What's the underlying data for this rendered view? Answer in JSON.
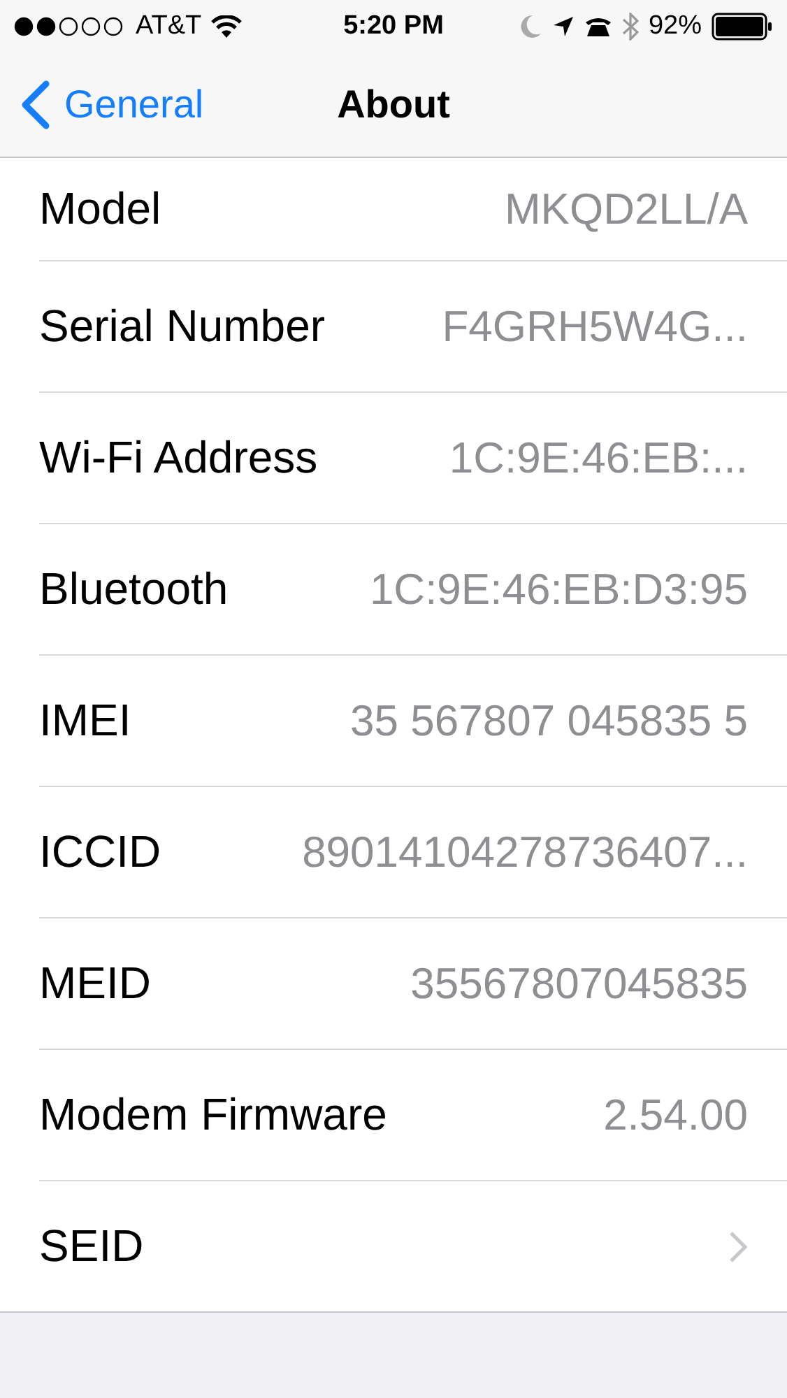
{
  "status_bar": {
    "carrier": "AT&T",
    "time": "5:20 PM",
    "battery": "92%"
  },
  "nav": {
    "back": "General",
    "title": "About"
  },
  "rows": [
    {
      "kind": "value",
      "label": "Model",
      "value": "MKQD2LL/A"
    },
    {
      "kind": "value",
      "label": "Serial Number",
      "value": "F4GRH5W4G..."
    },
    {
      "kind": "value",
      "label": "Wi-Fi Address",
      "value": "1C:9E:46:EB:..."
    },
    {
      "kind": "value",
      "label": "Bluetooth",
      "value": "1C:9E:46:EB:D3:95"
    },
    {
      "kind": "value",
      "label": "IMEI",
      "value": "35 567807 045835 5"
    },
    {
      "kind": "value",
      "label": "ICCID",
      "value": "89014104278736407..."
    },
    {
      "kind": "value",
      "label": "MEID",
      "value": "35567807045835"
    },
    {
      "kind": "value",
      "label": "Modem Firmware",
      "value": "2.54.00"
    },
    {
      "kind": "link",
      "label": "SEID"
    }
  ]
}
